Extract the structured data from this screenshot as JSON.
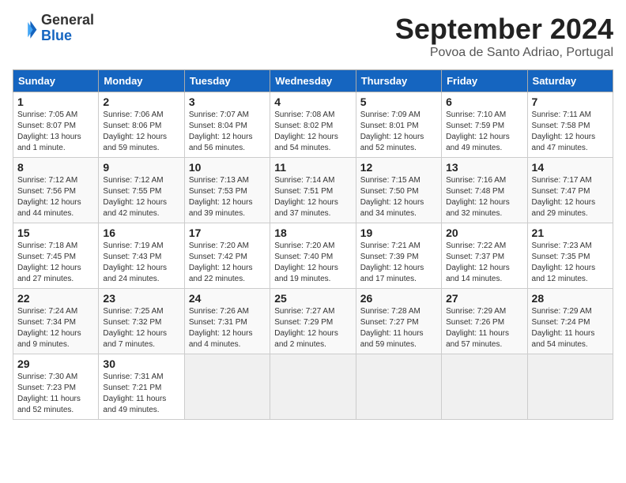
{
  "header": {
    "logo_general": "General",
    "logo_blue": "Blue",
    "month_title": "September 2024",
    "subtitle": "Povoa de Santo Adriao, Portugal"
  },
  "days_of_week": [
    "Sunday",
    "Monday",
    "Tuesday",
    "Wednesday",
    "Thursday",
    "Friday",
    "Saturday"
  ],
  "weeks": [
    [
      {
        "day": "1",
        "sunrise": "Sunrise: 7:05 AM",
        "sunset": "Sunset: 8:07 PM",
        "daylight": "Daylight: 13 hours and 1 minute."
      },
      {
        "day": "2",
        "sunrise": "Sunrise: 7:06 AM",
        "sunset": "Sunset: 8:06 PM",
        "daylight": "Daylight: 12 hours and 59 minutes."
      },
      {
        "day": "3",
        "sunrise": "Sunrise: 7:07 AM",
        "sunset": "Sunset: 8:04 PM",
        "daylight": "Daylight: 12 hours and 56 minutes."
      },
      {
        "day": "4",
        "sunrise": "Sunrise: 7:08 AM",
        "sunset": "Sunset: 8:02 PM",
        "daylight": "Daylight: 12 hours and 54 minutes."
      },
      {
        "day": "5",
        "sunrise": "Sunrise: 7:09 AM",
        "sunset": "Sunset: 8:01 PM",
        "daylight": "Daylight: 12 hours and 52 minutes."
      },
      {
        "day": "6",
        "sunrise": "Sunrise: 7:10 AM",
        "sunset": "Sunset: 7:59 PM",
        "daylight": "Daylight: 12 hours and 49 minutes."
      },
      {
        "day": "7",
        "sunrise": "Sunrise: 7:11 AM",
        "sunset": "Sunset: 7:58 PM",
        "daylight": "Daylight: 12 hours and 47 minutes."
      }
    ],
    [
      {
        "day": "8",
        "sunrise": "Sunrise: 7:12 AM",
        "sunset": "Sunset: 7:56 PM",
        "daylight": "Daylight: 12 hours and 44 minutes."
      },
      {
        "day": "9",
        "sunrise": "Sunrise: 7:12 AM",
        "sunset": "Sunset: 7:55 PM",
        "daylight": "Daylight: 12 hours and 42 minutes."
      },
      {
        "day": "10",
        "sunrise": "Sunrise: 7:13 AM",
        "sunset": "Sunset: 7:53 PM",
        "daylight": "Daylight: 12 hours and 39 minutes."
      },
      {
        "day": "11",
        "sunrise": "Sunrise: 7:14 AM",
        "sunset": "Sunset: 7:51 PM",
        "daylight": "Daylight: 12 hours and 37 minutes."
      },
      {
        "day": "12",
        "sunrise": "Sunrise: 7:15 AM",
        "sunset": "Sunset: 7:50 PM",
        "daylight": "Daylight: 12 hours and 34 minutes."
      },
      {
        "day": "13",
        "sunrise": "Sunrise: 7:16 AM",
        "sunset": "Sunset: 7:48 PM",
        "daylight": "Daylight: 12 hours and 32 minutes."
      },
      {
        "day": "14",
        "sunrise": "Sunrise: 7:17 AM",
        "sunset": "Sunset: 7:47 PM",
        "daylight": "Daylight: 12 hours and 29 minutes."
      }
    ],
    [
      {
        "day": "15",
        "sunrise": "Sunrise: 7:18 AM",
        "sunset": "Sunset: 7:45 PM",
        "daylight": "Daylight: 12 hours and 27 minutes."
      },
      {
        "day": "16",
        "sunrise": "Sunrise: 7:19 AM",
        "sunset": "Sunset: 7:43 PM",
        "daylight": "Daylight: 12 hours and 24 minutes."
      },
      {
        "day": "17",
        "sunrise": "Sunrise: 7:20 AM",
        "sunset": "Sunset: 7:42 PM",
        "daylight": "Daylight: 12 hours and 22 minutes."
      },
      {
        "day": "18",
        "sunrise": "Sunrise: 7:20 AM",
        "sunset": "Sunset: 7:40 PM",
        "daylight": "Daylight: 12 hours and 19 minutes."
      },
      {
        "day": "19",
        "sunrise": "Sunrise: 7:21 AM",
        "sunset": "Sunset: 7:39 PM",
        "daylight": "Daylight: 12 hours and 17 minutes."
      },
      {
        "day": "20",
        "sunrise": "Sunrise: 7:22 AM",
        "sunset": "Sunset: 7:37 PM",
        "daylight": "Daylight: 12 hours and 14 minutes."
      },
      {
        "day": "21",
        "sunrise": "Sunrise: 7:23 AM",
        "sunset": "Sunset: 7:35 PM",
        "daylight": "Daylight: 12 hours and 12 minutes."
      }
    ],
    [
      {
        "day": "22",
        "sunrise": "Sunrise: 7:24 AM",
        "sunset": "Sunset: 7:34 PM",
        "daylight": "Daylight: 12 hours and 9 minutes."
      },
      {
        "day": "23",
        "sunrise": "Sunrise: 7:25 AM",
        "sunset": "Sunset: 7:32 PM",
        "daylight": "Daylight: 12 hours and 7 minutes."
      },
      {
        "day": "24",
        "sunrise": "Sunrise: 7:26 AM",
        "sunset": "Sunset: 7:31 PM",
        "daylight": "Daylight: 12 hours and 4 minutes."
      },
      {
        "day": "25",
        "sunrise": "Sunrise: 7:27 AM",
        "sunset": "Sunset: 7:29 PM",
        "daylight": "Daylight: 12 hours and 2 minutes."
      },
      {
        "day": "26",
        "sunrise": "Sunrise: 7:28 AM",
        "sunset": "Sunset: 7:27 PM",
        "daylight": "Daylight: 11 hours and 59 minutes."
      },
      {
        "day": "27",
        "sunrise": "Sunrise: 7:29 AM",
        "sunset": "Sunset: 7:26 PM",
        "daylight": "Daylight: 11 hours and 57 minutes."
      },
      {
        "day": "28",
        "sunrise": "Sunrise: 7:29 AM",
        "sunset": "Sunset: 7:24 PM",
        "daylight": "Daylight: 11 hours and 54 minutes."
      }
    ],
    [
      {
        "day": "29",
        "sunrise": "Sunrise: 7:30 AM",
        "sunset": "Sunset: 7:23 PM",
        "daylight": "Daylight: 11 hours and 52 minutes."
      },
      {
        "day": "30",
        "sunrise": "Sunrise: 7:31 AM",
        "sunset": "Sunset: 7:21 PM",
        "daylight": "Daylight: 11 hours and 49 minutes."
      },
      null,
      null,
      null,
      null,
      null
    ]
  ]
}
